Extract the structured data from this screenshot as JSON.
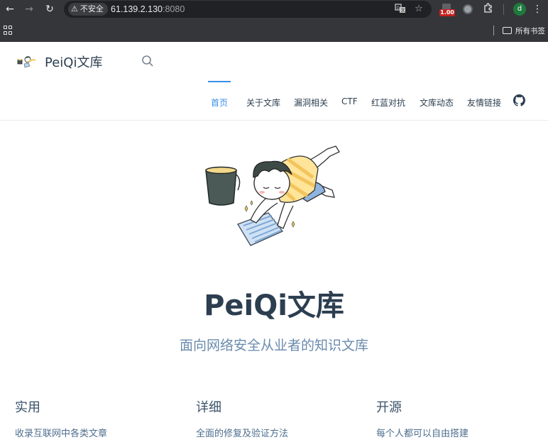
{
  "browser": {
    "security_label": "不安全",
    "url_host": "61.139.2.130",
    "url_port": ":8080",
    "extension_badge": "1.00",
    "profile_initial": "d",
    "bookmarks_all_label": "所有书签"
  },
  "site": {
    "name": "PeiQi文库",
    "nav": [
      {
        "label": "首页",
        "active": true
      },
      {
        "label": "关于文库"
      },
      {
        "label": "漏洞相关"
      },
      {
        "label": "CTF"
      },
      {
        "label": "红蓝对抗"
      },
      {
        "label": "文库动态"
      },
      {
        "label": "友情链接"
      }
    ],
    "accent_color": "#3a8ee6"
  },
  "hero": {
    "title": "PeiQi文库",
    "description": "面向网络安全从业者的知识文库"
  },
  "features": [
    {
      "title": "实用",
      "details": "收录互联网中各类文章"
    },
    {
      "title": "详细",
      "details": "全面的修复及验证方法"
    },
    {
      "title": "开源",
      "details": "每个人都可以自由搭建"
    }
  ]
}
